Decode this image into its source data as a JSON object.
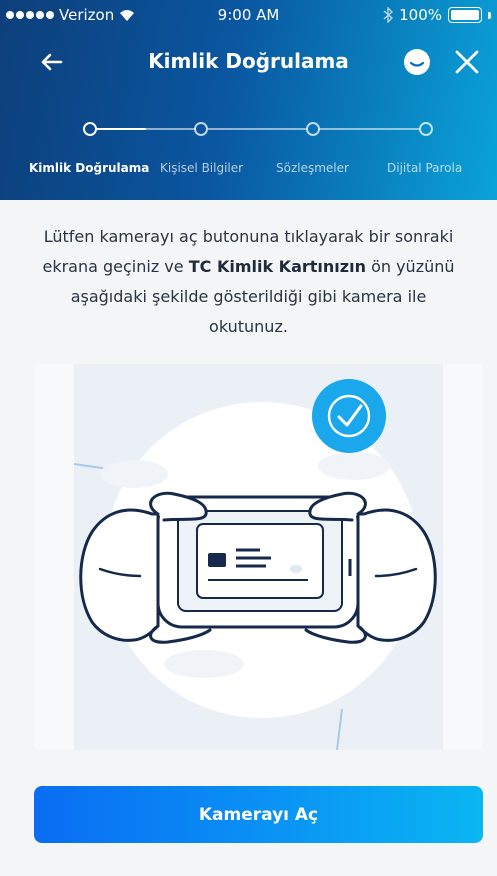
{
  "status": {
    "carrier": "Verizon",
    "time": "9:00 AM",
    "battery": "100%"
  },
  "nav": {
    "title": "Kimlik Doğrulama"
  },
  "steps": [
    {
      "label": "Kimlik Doğrulama",
      "active": true
    },
    {
      "label": "Kişisel Bilgiler",
      "active": false
    },
    {
      "label": "Sözleşmeler",
      "active": false
    },
    {
      "label": "Dijital Parola",
      "active": false
    }
  ],
  "instruction": {
    "part1": "Lütfen kamerayı aç butonuna tıklayarak bir sonraki ekrana geçiniz ve",
    "bold": "TC Kimlik Kartınızın",
    "part2": "ön yüzünü aşağıdaki şekilde gösterildiği gibi kamera ile okutunuz."
  },
  "button": {
    "label": "Kamerayı Aç"
  },
  "colors": {
    "header_start": "#0d3f7a",
    "header_end": "#0aa3d8",
    "button_start": "#0a6df2",
    "button_end": "#0ab6f2",
    "check_badge": "#1aa7ec"
  },
  "icons": {
    "back": "arrow-left",
    "chat": "chat-bubble",
    "close": "close-x",
    "verified": "check-circle"
  }
}
